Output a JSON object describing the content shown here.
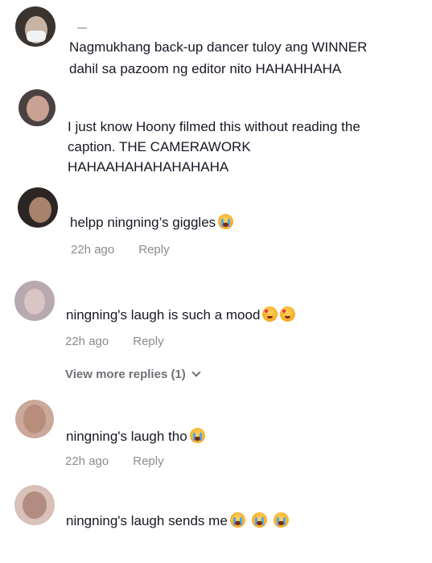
{
  "comments": [
    {
      "text_line1": "Nagmukhang back-up dancer tuloy ang WINNER",
      "text_line2": "dahil sa pazoom ng editor nito HAHAHHAHA"
    },
    {
      "text_line1": "I just know Hoony filmed this without reading the",
      "text_line2": "caption. THE CAMERAWORK",
      "text_line3": "HAHAAHAHAHAHAHAHA"
    },
    {
      "text": "helpp ningning’s giggles",
      "emoji": "loudly-crying-face",
      "time": "22h ago",
      "reply": "Reply"
    },
    {
      "text": "ningning's laugh is such a mood",
      "emoji": "smiling-face-with-heart-eyes",
      "time": "22h ago",
      "reply": "Reply",
      "view_more": "View more replies (1)"
    },
    {
      "text": "ningning's laugh tho",
      "emoji": "loudly-crying-face",
      "time": "22h ago",
      "reply": "Reply"
    },
    {
      "text": "ningning's laugh sends me",
      "emoji": "loudly-crying-face"
    }
  ],
  "colors": {
    "text": "#161823",
    "meta": "#8a8b91",
    "background": "#ffffff"
  }
}
